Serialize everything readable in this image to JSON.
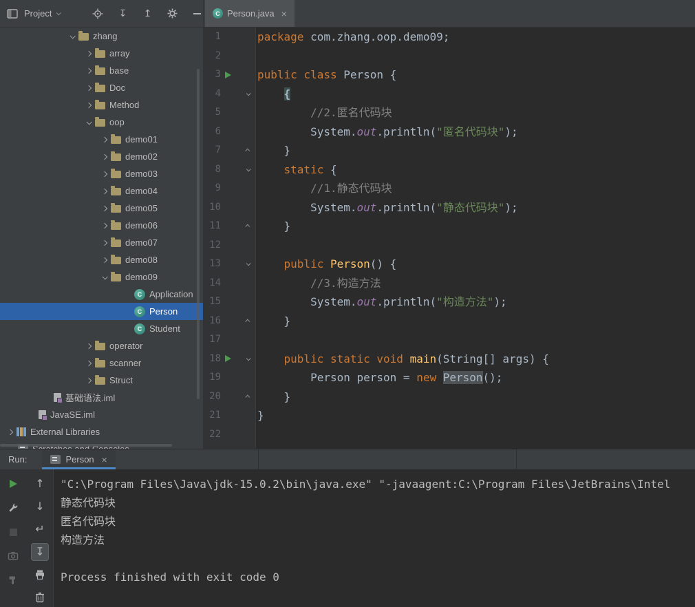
{
  "colors": {
    "selection_blue": "#2E62A8",
    "keyword_orange": "#CC7832",
    "string_green": "#6A8759",
    "method_yellow": "#FFC66B",
    "run_green": "#4C9B4F",
    "tab_underline_blue": "#4A88C7"
  },
  "toolbar": {
    "project_label": "Project",
    "icons": [
      {
        "name": "locate-file-icon",
        "icon": "locate"
      },
      {
        "name": "collapse-all-icon",
        "icon": "collapse-all"
      },
      {
        "name": "expand-all-icon",
        "icon": "expand-all"
      },
      {
        "name": "settings-gear-icon",
        "icon": "gear"
      },
      {
        "name": "hide-panel-icon",
        "icon": "minus"
      }
    ]
  },
  "editor_tab": {
    "title": "Person.java",
    "close": "×"
  },
  "tree": {
    "rows": [
      {
        "label": "zhang",
        "icon": "folder",
        "chevron": "expanded",
        "indent": 96
      },
      {
        "label": "array",
        "icon": "folder",
        "chevron": "collapsed",
        "indent": 120
      },
      {
        "label": "base",
        "icon": "folder",
        "chevron": "collapsed",
        "indent": 120
      },
      {
        "label": "Doc",
        "icon": "folder",
        "chevron": "collapsed",
        "indent": 120
      },
      {
        "label": "Method",
        "icon": "folder",
        "chevron": "collapsed",
        "indent": 120
      },
      {
        "label": "oop",
        "icon": "folder",
        "chevron": "expanded",
        "indent": 120
      },
      {
        "label": "demo01",
        "icon": "folder",
        "chevron": "collapsed",
        "indent": 143
      },
      {
        "label": "demo02",
        "icon": "folder",
        "chevron": "collapsed",
        "indent": 143
      },
      {
        "label": "demo03",
        "icon": "folder",
        "chevron": "collapsed",
        "indent": 143
      },
      {
        "label": "demo04",
        "icon": "folder",
        "chevron": "collapsed",
        "indent": 143
      },
      {
        "label": "demo05",
        "icon": "folder",
        "chevron": "collapsed",
        "indent": 143
      },
      {
        "label": "demo06",
        "icon": "folder",
        "chevron": "collapsed",
        "indent": 143
      },
      {
        "label": "demo07",
        "icon": "folder",
        "chevron": "collapsed",
        "indent": 143
      },
      {
        "label": "demo08",
        "icon": "folder",
        "chevron": "collapsed",
        "indent": 143
      },
      {
        "label": "demo09",
        "icon": "folder",
        "chevron": "expanded",
        "indent": 143
      },
      {
        "label": "Application",
        "icon": "class",
        "chevron": "none",
        "indent": 195
      },
      {
        "label": "Person",
        "icon": "class",
        "chevron": "none",
        "indent": 195,
        "selected": true
      },
      {
        "label": "Student",
        "icon": "class",
        "chevron": "none",
        "indent": 195
      },
      {
        "label": "operator",
        "icon": "folder",
        "chevron": "collapsed",
        "indent": 120
      },
      {
        "label": "scanner",
        "icon": "folder",
        "chevron": "collapsed",
        "indent": 120
      },
      {
        "label": "Struct",
        "icon": "folder",
        "chevron": "collapsed",
        "indent": 120
      },
      {
        "label": "基础语法.iml",
        "icon": "iml",
        "chevron": "none",
        "indent": 78
      },
      {
        "label": "JavaSE.iml",
        "icon": "iml",
        "chevron": "none",
        "indent": 56
      },
      {
        "label": "External Libraries",
        "icon": "library",
        "chevron": "collapsed",
        "indent": 6
      },
      {
        "label": "Scratches and Consoles",
        "icon": "console",
        "chevron": "none",
        "indent": 26
      }
    ]
  },
  "editor": {
    "lines": [
      {
        "n": 1,
        "tokens": [
          {
            "c": "kw",
            "t": "package"
          },
          {
            "c": "def",
            "t": " com.zhang.oop.demo09;"
          }
        ]
      },
      {
        "n": 2,
        "tokens": []
      },
      {
        "n": 3,
        "run": true,
        "tokens": [
          {
            "c": "kw",
            "t": "public class"
          },
          {
            "c": "def",
            "t": " Person {"
          }
        ]
      },
      {
        "n": 4,
        "fold": "open",
        "tokens": [
          {
            "c": "def",
            "t": "    "
          },
          {
            "c": "hl",
            "t": "{"
          }
        ]
      },
      {
        "n": 5,
        "tokens": [
          {
            "c": "def",
            "t": "        "
          },
          {
            "c": "com",
            "t": "//2.匿名代码块"
          }
        ]
      },
      {
        "n": 6,
        "tokens": [
          {
            "c": "def",
            "t": "        System."
          },
          {
            "c": "field",
            "t": "out"
          },
          {
            "c": "def",
            "t": ".println("
          },
          {
            "c": "str",
            "t": "\"匿名代码块\""
          },
          {
            "c": "def",
            "t": ");"
          }
        ]
      },
      {
        "n": 7,
        "fold": "close",
        "tokens": [
          {
            "c": "def",
            "t": "    }"
          }
        ]
      },
      {
        "n": 8,
        "fold": "open",
        "tokens": [
          {
            "c": "def",
            "t": "    "
          },
          {
            "c": "kw",
            "t": "static"
          },
          {
            "c": "def",
            "t": " {"
          }
        ]
      },
      {
        "n": 9,
        "tokens": [
          {
            "c": "def",
            "t": "        "
          },
          {
            "c": "com",
            "t": "//1.静态代码块"
          }
        ]
      },
      {
        "n": 10,
        "tokens": [
          {
            "c": "def",
            "t": "        System."
          },
          {
            "c": "field",
            "t": "out"
          },
          {
            "c": "def",
            "t": ".println("
          },
          {
            "c": "str",
            "t": "\"静态代码块\""
          },
          {
            "c": "def",
            "t": ");"
          }
        ]
      },
      {
        "n": 11,
        "fold": "close",
        "tokens": [
          {
            "c": "def",
            "t": "    }"
          }
        ]
      },
      {
        "n": 12,
        "tokens": []
      },
      {
        "n": 13,
        "fold": "open",
        "tokens": [
          {
            "c": "def",
            "t": "    "
          },
          {
            "c": "kw",
            "t": "public "
          },
          {
            "c": "meth",
            "t": "Person"
          },
          {
            "c": "def",
            "t": "() {"
          }
        ]
      },
      {
        "n": 14,
        "tokens": [
          {
            "c": "def",
            "t": "        "
          },
          {
            "c": "com",
            "t": "//3.构造方法"
          }
        ]
      },
      {
        "n": 15,
        "tokens": [
          {
            "c": "def",
            "t": "        System."
          },
          {
            "c": "field",
            "t": "out"
          },
          {
            "c": "def",
            "t": ".println("
          },
          {
            "c": "str",
            "t": "\"构造方法\""
          },
          {
            "c": "def",
            "t": ");"
          }
        ]
      },
      {
        "n": 16,
        "fold": "close",
        "tokens": [
          {
            "c": "def",
            "t": "    }"
          }
        ]
      },
      {
        "n": 17,
        "tokens": []
      },
      {
        "n": 18,
        "run": true,
        "fold": "open",
        "tokens": [
          {
            "c": "def",
            "t": "    "
          },
          {
            "c": "kw",
            "t": "public static void "
          },
          {
            "c": "meth",
            "t": "main"
          },
          {
            "c": "def",
            "t": "(String[] args) {"
          }
        ]
      },
      {
        "n": 19,
        "tokens": [
          {
            "c": "def",
            "t": "        Person person = "
          },
          {
            "c": "kw",
            "t": "new"
          },
          {
            "c": "def",
            "t": " "
          },
          {
            "c": "occ",
            "t": "Person"
          },
          {
            "c": "def",
            "t": "();"
          }
        ]
      },
      {
        "n": 20,
        "fold": "close",
        "tokens": [
          {
            "c": "def",
            "t": "    }"
          }
        ]
      },
      {
        "n": 21,
        "tokens": [
          {
            "c": "def",
            "t": "}"
          }
        ]
      },
      {
        "n": 22,
        "tokens": []
      }
    ]
  },
  "run": {
    "label": "Run:",
    "tab": "Person",
    "close": "×",
    "toolbar": {
      "col1": [
        {
          "name": "rerun-button",
          "icon": "play"
        },
        {
          "name": "edit-settings-button",
          "icon": "wrench"
        },
        {
          "name": "stop-button",
          "icon": "stop",
          "state": "disabled"
        },
        {
          "name": "dump-threads-button",
          "icon": "camera",
          "state": "disabled"
        },
        {
          "name": "build-button",
          "icon": "hammer",
          "state": "disabled"
        }
      ],
      "col2": [
        {
          "name": "up-stack-trace-button",
          "icon": "arrow-up"
        },
        {
          "name": "down-stack-trace-button",
          "icon": "arrow-down"
        },
        {
          "name": "soft-wrap-button",
          "icon": "wrap"
        },
        {
          "name": "scroll-to-end-button",
          "icon": "scroll-end",
          "state": "selected"
        },
        {
          "name": "print-button",
          "icon": "printer"
        },
        {
          "name": "clear-all-button",
          "icon": "trash"
        }
      ]
    },
    "console": [
      "\"C:\\Program Files\\Java\\jdk-15.0.2\\bin\\java.exe\" \"-javaagent:C:\\Program Files\\JetBrains\\Intel",
      "静态代码块",
      "匿名代码块",
      "构造方法",
      "",
      "Process finished with exit code 0"
    ]
  }
}
